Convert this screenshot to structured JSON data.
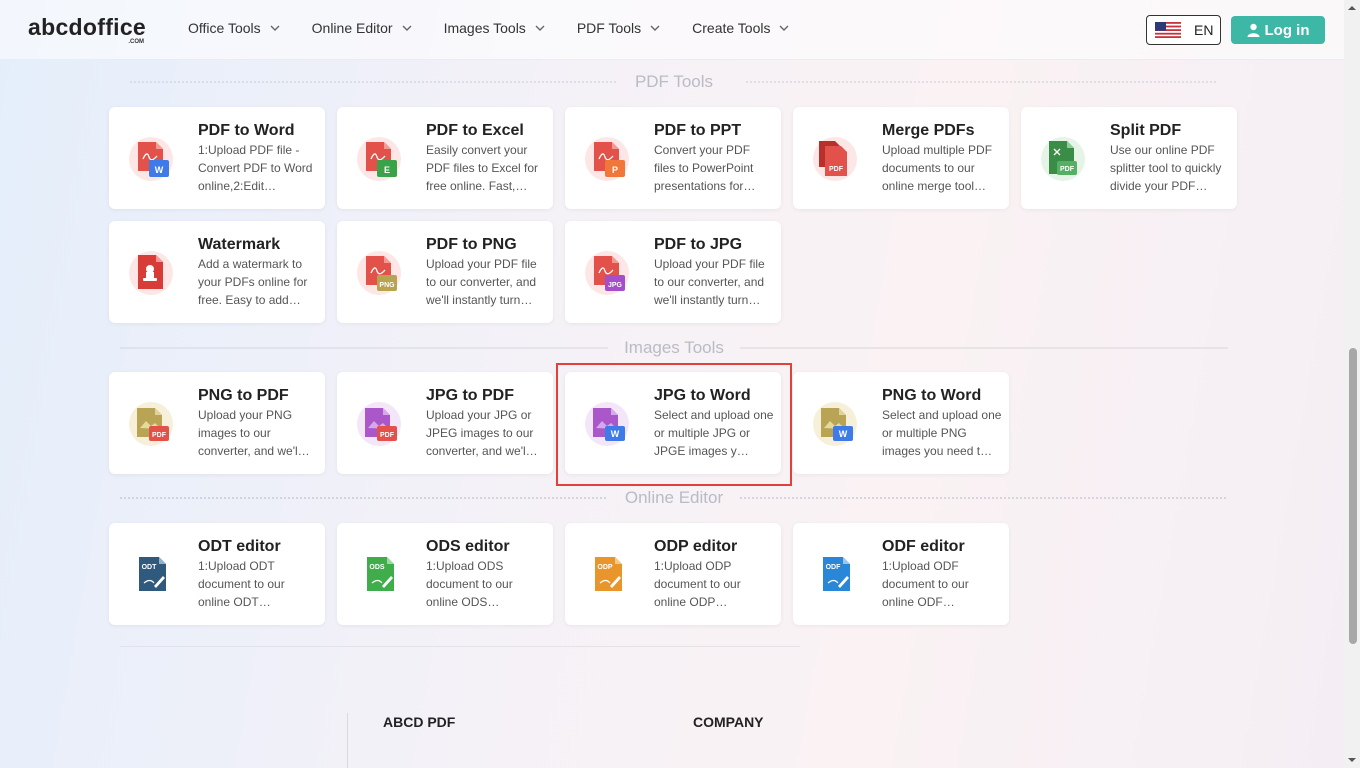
{
  "header": {
    "logo": "abcdoffice",
    "logo_sub": ".COM",
    "nav": [
      {
        "label": "Office Tools"
      },
      {
        "label": "Online Editor"
      },
      {
        "label": "Images Tools"
      },
      {
        "label": "PDF Tools"
      },
      {
        "label": "Create Tools"
      }
    ],
    "lang": "EN",
    "login": "Log in"
  },
  "sections": {
    "pdf": "PDF Tools",
    "images": "Images Tools",
    "editor": "Online Editor"
  },
  "pdf_tools": [
    {
      "title": "PDF to Word",
      "desc": "1:Upload PDF file - Convert PDF to Word online,2:Edit…",
      "icon": "pdf-to-word-icon"
    },
    {
      "title": "PDF to Excel",
      "desc": "Easily convert your PDF files to Excel for free online. Fast,…",
      "icon": "pdf-to-excel-icon"
    },
    {
      "title": "PDF to PPT",
      "desc": "Convert your PDF files to PowerPoint presentations for…",
      "icon": "pdf-to-ppt-icon"
    },
    {
      "title": "Merge PDFs",
      "desc": "Upload multiple PDF documents to our online merge tool…",
      "icon": "merge-pdfs-icon"
    },
    {
      "title": "Split PDF",
      "desc": "Use our online PDF splitter tool to quickly divide your PDF…",
      "icon": "split-pdf-icon"
    },
    {
      "title": "Watermark",
      "desc": "Add a watermark to your PDFs online for free. Easy to add…",
      "icon": "watermark-icon"
    },
    {
      "title": "PDF to PNG",
      "desc": "Upload your PDF file to our converter, and we'll instantly turn…",
      "icon": "pdf-to-png-icon"
    },
    {
      "title": "PDF to JPG",
      "desc": "Upload your PDF file to our converter, and we'll instantly turn…",
      "icon": "pdf-to-jpg-icon"
    }
  ],
  "image_tools": [
    {
      "title": "PNG to PDF",
      "desc": "Upload your PNG images to our converter, and we'l…",
      "icon": "png-to-pdf-icon"
    },
    {
      "title": "JPG to PDF",
      "desc": "Upload your JPG or JPEG images to our converter, and we'l…",
      "icon": "jpg-to-pdf-icon"
    },
    {
      "title": "JPG to Word",
      "desc": "Select and upload one or multiple JPG or JPGE images y…",
      "icon": "jpg-to-word-icon"
    },
    {
      "title": "PNG to Word",
      "desc": "Select and upload one or multiple PNG images you need t…",
      "icon": "png-to-word-icon"
    }
  ],
  "editor_tools": [
    {
      "title": "ODT editor",
      "desc": "1:Upload ODT document to our online ODT…",
      "icon": "odt-editor-icon",
      "badge": "ODT"
    },
    {
      "title": "ODS editor",
      "desc": "1:Upload ODS document to our online ODS…",
      "icon": "ods-editor-icon",
      "badge": "ODS"
    },
    {
      "title": "ODP editor",
      "desc": "1:Upload ODP document to our online ODP…",
      "icon": "odp-editor-icon",
      "badge": "ODP"
    },
    {
      "title": "ODF editor",
      "desc": "1:Upload ODF document to our online ODF…",
      "icon": "odf-editor-icon",
      "badge": "ODF"
    }
  ],
  "icon_labels": {
    "w": "W",
    "e": "E",
    "p": "P",
    "pdf": "PDF",
    "png": "PNG",
    "jpg": "JPG"
  },
  "footer": {
    "col1": "ABCD PDF",
    "col2": "COMPANY"
  },
  "colors": {
    "accent": "#3db8a6",
    "pdf_red": "#e2524a",
    "highlight": "#e0413a"
  }
}
